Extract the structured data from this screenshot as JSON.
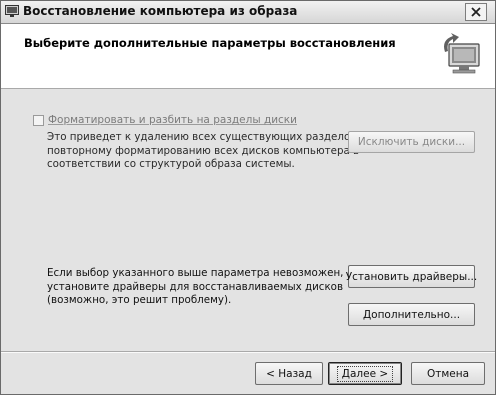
{
  "window": {
    "title": "Восстановление компьютера из образа",
    "close_symbol": "✕"
  },
  "header": {
    "title": "Выберите дополнительные параметры восстановления",
    "icon": "computer-restore-icon"
  },
  "format_option": {
    "checked": false,
    "enabled": false,
    "label": "Форматировать и разбить на разделы диски",
    "description": [
      "Это приведет к удалению всех существующих разделов и",
      "повторному форматированию всех дисков компьютера в",
      "соответствии со структурой образа системы."
    ],
    "exclude_button": "Исключить диски..."
  },
  "drivers": {
    "description": [
      "Если выбор указанного выше параметра невозможен,",
      "установите драйверы для восстанавливаемых дисков",
      "(возможно, это решит проблему)."
    ],
    "install_button": "Установить драйверы...",
    "advanced_button": "Дополнительно..."
  },
  "footer": {
    "back_button": "< Назад",
    "next_button": "Далее >",
    "cancel_button": "Отмена"
  }
}
